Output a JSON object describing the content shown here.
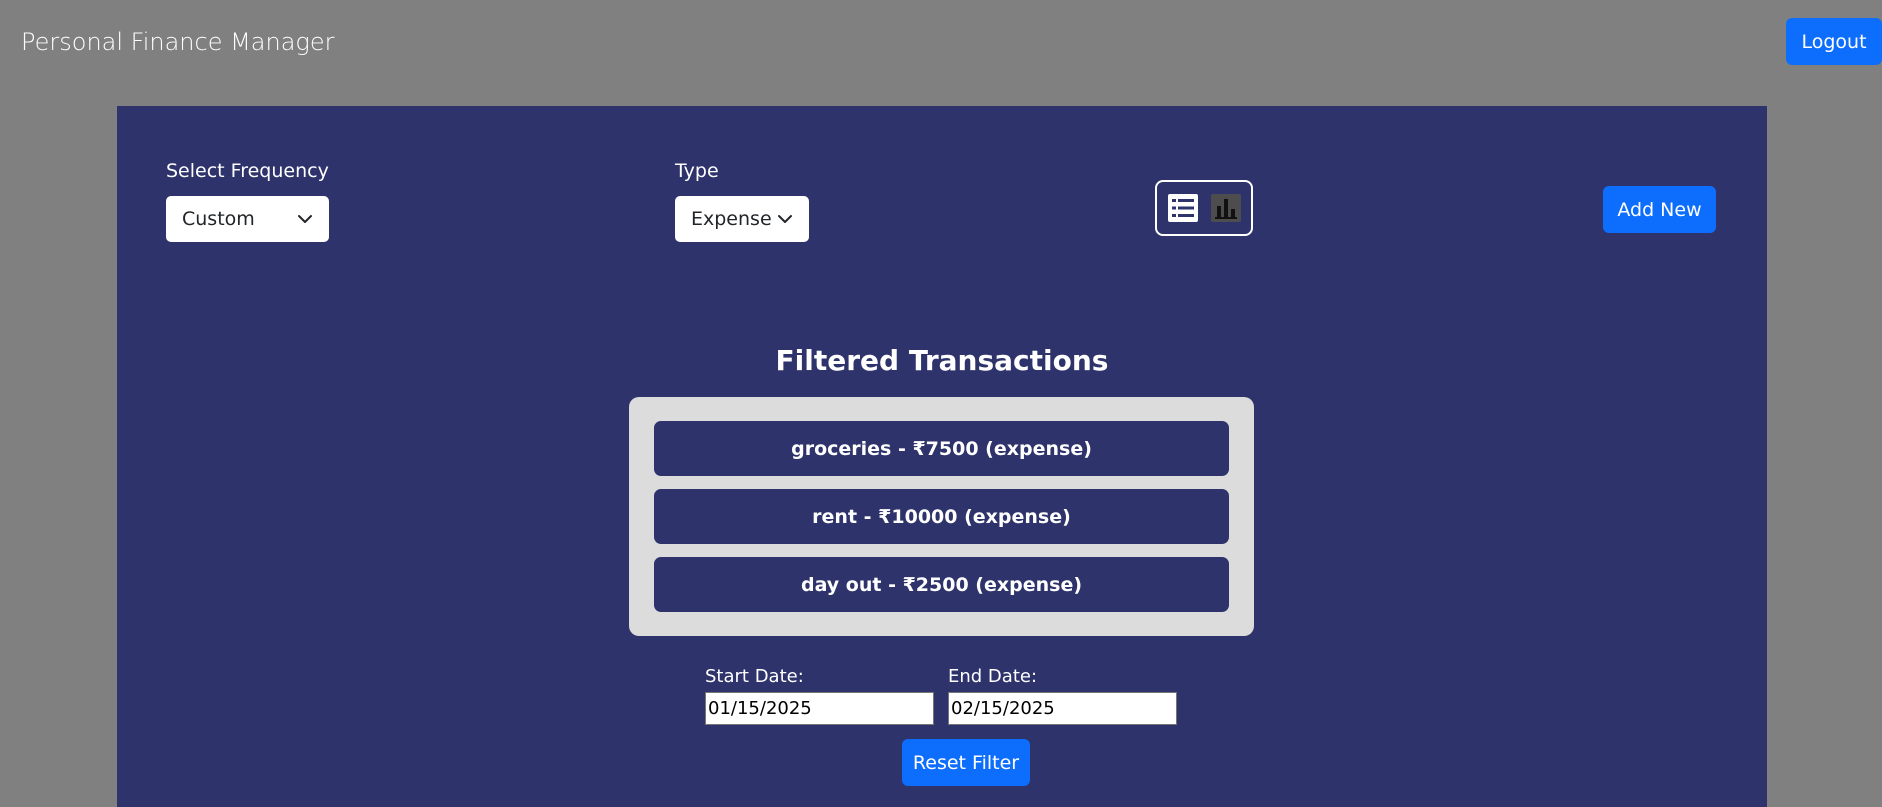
{
  "app": {
    "title": "Personal Finance Manager",
    "logout_label": "Logout"
  },
  "filters": {
    "frequency_label": "Select Frequency",
    "frequency_value": "Custom",
    "type_label": "Type",
    "type_value": "Expense"
  },
  "view_toggle": {
    "options": [
      "list-icon",
      "bar-chart-icon"
    ]
  },
  "actions": {
    "add_new_label": "Add New",
    "reset_filter_label": "Reset Filter"
  },
  "transactions": {
    "title": "Filtered Transactions",
    "items": [
      "groceries - ₹7500 (expense)",
      "rent - ₹10000 (expense)",
      "day out - ₹2500 (expense)"
    ]
  },
  "date_range": {
    "start_label": "Start Date:",
    "start_value": "01/15/2025",
    "end_label": "End Date:",
    "end_value": "02/15/2025"
  },
  "colors": {
    "page_bg": "#808080",
    "panel_bg": "#2e336b",
    "accent": "#0d6efd",
    "list_bg": "#dcdcdc"
  }
}
